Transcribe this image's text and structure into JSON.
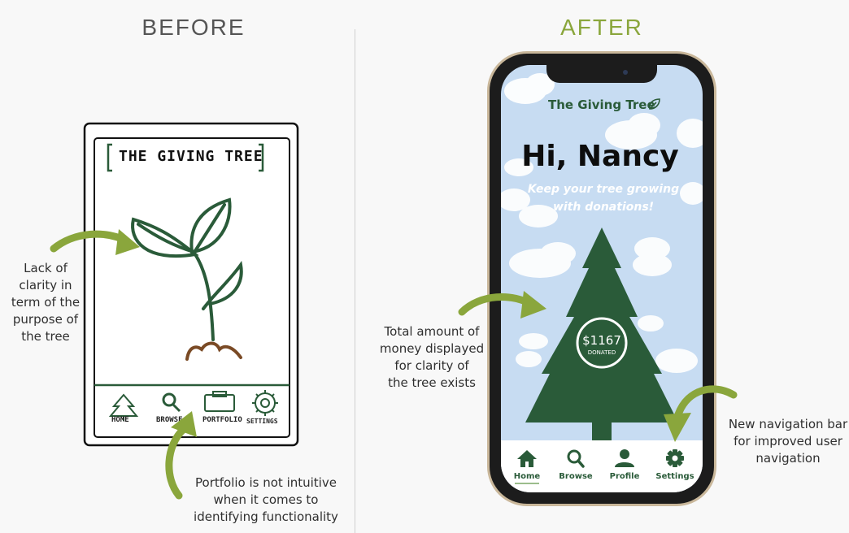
{
  "before": {
    "heading": "BEFORE",
    "heading_color": "#555555",
    "sketch_title": "THE GIVING TREE",
    "nav": [
      "HOME",
      "BROWSE",
      "PORTFOLIO",
      "SETTINGS"
    ],
    "notes": {
      "clarity": [
        "Lack of",
        "clarity in",
        "term of the",
        "purpose of",
        "the tree"
      ],
      "portfolio": [
        "Portfolio is not intuitive",
        "when it comes to",
        "identifying functionality"
      ]
    }
  },
  "after": {
    "heading": "AFTER",
    "heading_color": "#8aa63c",
    "app_title": "The Giving Tree",
    "greeting": "Hi, Nancy",
    "subtitle": [
      "Keep your tree growing",
      "with donations!"
    ],
    "donation": {
      "amount": "$1167",
      "label": "DONATED"
    },
    "nav": [
      {
        "label": "Home",
        "icon": "home-icon"
      },
      {
        "label": "Browse",
        "icon": "search-icon"
      },
      {
        "label": "Profile",
        "icon": "person-icon"
      },
      {
        "label": "Settings",
        "icon": "gear-icon"
      }
    ],
    "notes": {
      "total": [
        "Total amount of",
        "money displayed",
        "for clarity of",
        "the tree exists"
      ],
      "navbar": [
        "New navigation bar",
        "for improved user",
        "navigation"
      ]
    }
  },
  "colors": {
    "arrow": "#8aa63c",
    "tree": "#2a5b39",
    "sky": "#c7dcf2"
  }
}
